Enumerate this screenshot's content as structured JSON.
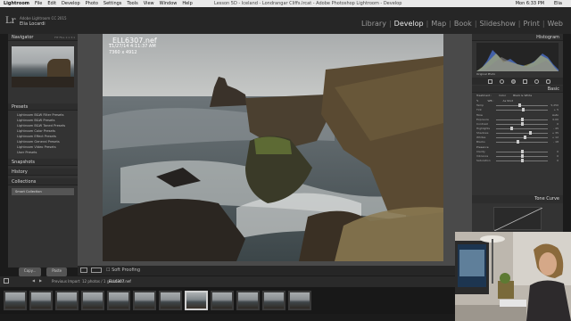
{
  "menubar": {
    "app": "Lightroom",
    "items": [
      "File",
      "Edit",
      "Develop",
      "Photo",
      "Settings",
      "Tools",
      "View",
      "Window",
      "Help"
    ],
    "window_title": "Lesson 5D - Iceland - Londrangar Cliffs.lrcat - Adobe Photoshop Lightroom - Develop",
    "clock": "Mon 6:33 PM",
    "user": "Elia"
  },
  "header": {
    "logo": "Lr",
    "catalog_line1": "Adobe Lightroom CC 2015",
    "catalog_line2": "Elia Locardi",
    "modules": [
      "Library",
      "Develop",
      "Map",
      "Book",
      "Slideshow",
      "Print",
      "Web"
    ],
    "active_module": "Develop"
  },
  "left_panel": {
    "navigator_label": "Navigator",
    "navigator_modes": "FIT  FILL  1:1  3:1",
    "presets_label": "Presets",
    "presets": [
      "Lightroom B&W Filter Presets",
      "Lightroom B&W Presets",
      "Lightroom B&W Toned Presets",
      "Lightroom Color Presets",
      "Lightroom Effect Presets",
      "Lightroom General Presets",
      "Lightroom Video Presets",
      "User Presets"
    ],
    "snapshots_label": "Snapshots",
    "history_label": "History",
    "collections_label": "Collections",
    "collection_item": "Smart Collection",
    "copy_button": "Copy...",
    "paste_button": "Paste"
  },
  "photo": {
    "filename": "_ELL6307.nef",
    "date": "11/27/14 4:11:37 AM",
    "dimensions": "7360 x 4912"
  },
  "toolbar": {
    "soft_proofing": "Soft Proofing"
  },
  "filmstrip": {
    "previous_import": "Previous Import",
    "count": "12 photos / 1 selected /",
    "selected_file": "_ELL6307.nef",
    "thumbnails": 12,
    "selected_index": 7
  },
  "right_panel": {
    "histogram_label": "Histogram",
    "camera_info": "ISO 200   14 mm   f/11   1/2 sec",
    "original_photo": "Original Photo",
    "basic_label": "Basic",
    "treatment_label": "Treatment :",
    "treatment_color": "Color",
    "treatment_bw": "Black & White",
    "wb_label": "WB :",
    "wb_value": "As Shot",
    "tone_label": "Tone",
    "tone_auto": "Auto",
    "presence_label": "Presence",
    "sliders": [
      {
        "label": "Temp",
        "value": "5,250",
        "pos": 0.45
      },
      {
        "label": "Tint",
        "value": "+ 5",
        "pos": 0.52
      },
      {
        "label": "Exposure",
        "value": "0.00",
        "pos": 0.5
      },
      {
        "label": "Contrast",
        "value": "0",
        "pos": 0.5
      },
      {
        "label": "Highlights",
        "value": "- 45",
        "pos": 0.3
      },
      {
        "label": "Shadows",
        "value": "+ 35",
        "pos": 0.66
      },
      {
        "label": "Whites",
        "value": "+ 12",
        "pos": 0.56
      },
      {
        "label": "Blacks",
        "value": "- 18",
        "pos": 0.42
      },
      {
        "label": "Clarity",
        "value": "0",
        "pos": 0.5
      },
      {
        "label": "Vibrance",
        "value": "0",
        "pos": 0.5
      },
      {
        "label": "Saturation",
        "value": "0",
        "pos": 0.5
      }
    ],
    "tone_curve_label": "Tone Curve"
  },
  "colors": {
    "panel": "#333333",
    "background": "#4a4a4a",
    "accent": "#d8d8d8"
  }
}
